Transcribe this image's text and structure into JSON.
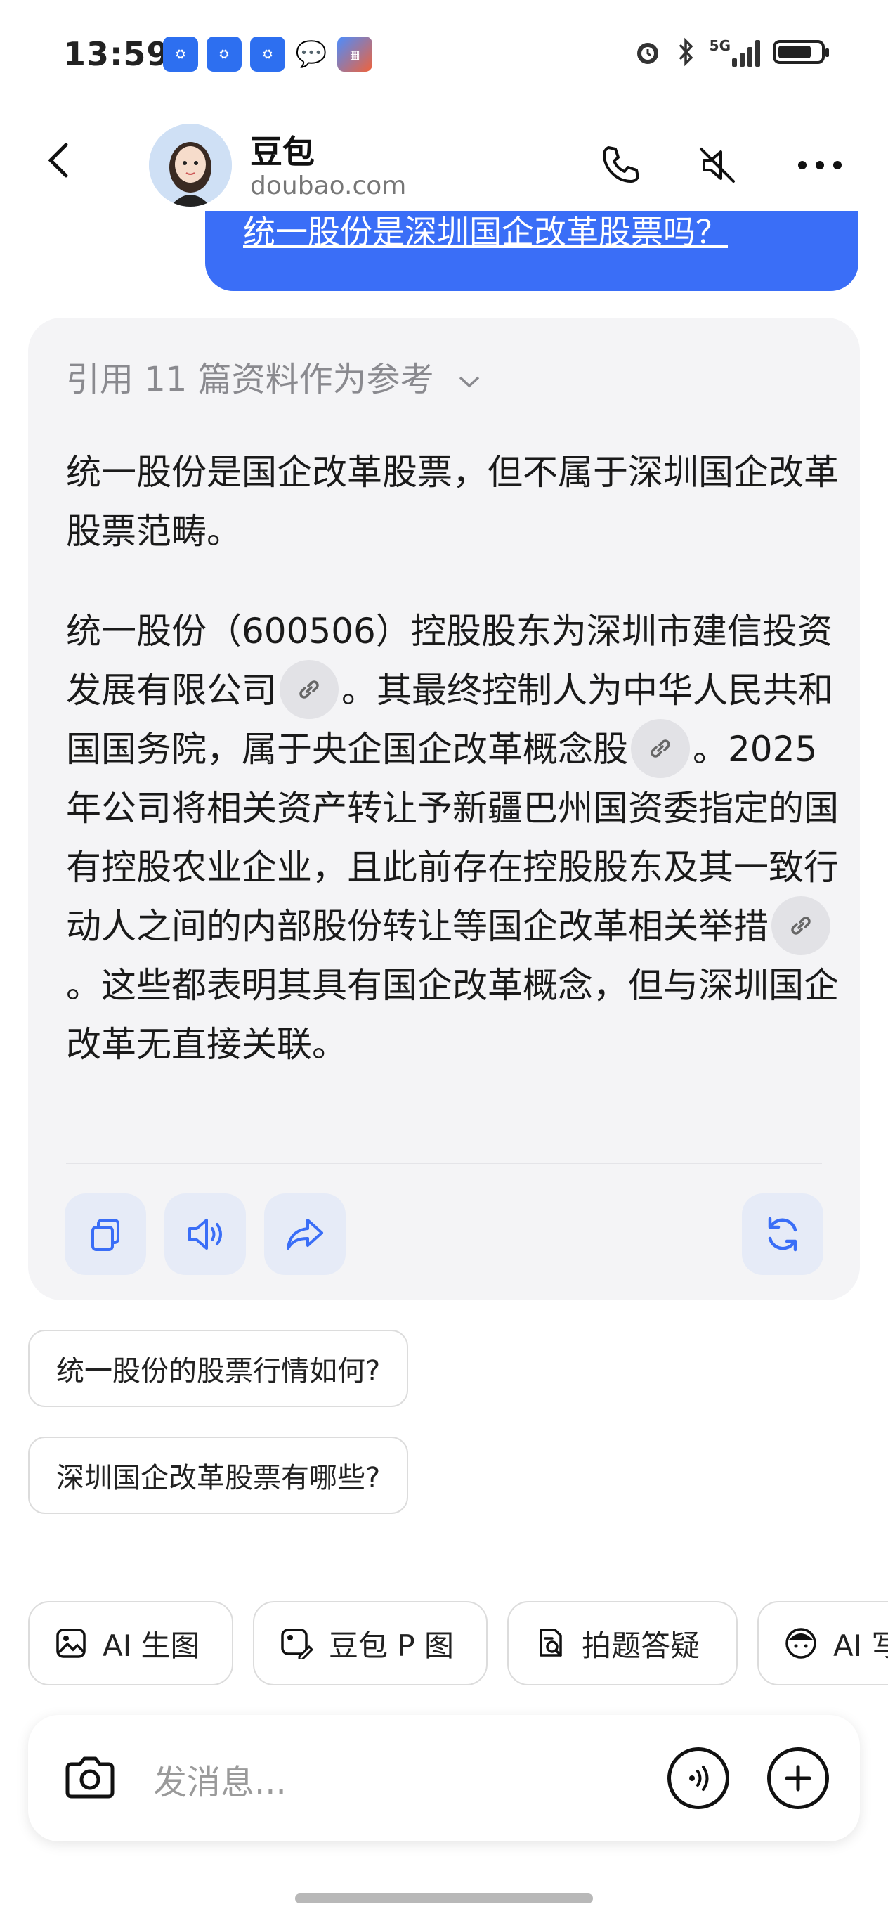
{
  "status_bar": {
    "time": "13:59",
    "network": "5G"
  },
  "header": {
    "title": "豆包",
    "subtitle": "doubao.com"
  },
  "user_message": "统一股份是深圳国企改革股票吗？",
  "answer": {
    "references_label": "引用 11 篇资料作为参考",
    "paragraph1": "统一股份是国企改革股票，但不属于深圳国企改革股票范畴。",
    "p2_seg1": "统一股份（600506）控股股东为深圳市建信投资发展有限公司",
    "p2_seg2": "。其最终控制人为中华人民共和国国务院，属于央企国企改革概念股",
    "p2_seg3": "。2025年公司将相关资产转让予新疆巴州国资委指定的国有控股农业企业，且此前存在控股股东及其一致行动人之间的内部股份转让等国企改革相关举措",
    "p2_seg4": "。这些都表明其具有国企改革概念，但与深圳国企改革无直接关联。"
  },
  "suggestions": [
    "统一股份的股票行情如何?",
    "深圳国企改革股票有哪些?"
  ],
  "tools": [
    {
      "label": "AI 生图",
      "icon": "image-icon"
    },
    {
      "label": "豆包 P 图",
      "icon": "photo-edit-icon"
    },
    {
      "label": "拍题答疑",
      "icon": "scan-question-icon"
    },
    {
      "label": "AI 写",
      "icon": "ai-write-icon"
    }
  ],
  "input": {
    "placeholder": "发消息..."
  },
  "colors": {
    "accent": "#3a6ef7",
    "card_bg": "#f4f4f6",
    "action_btn_bg": "#e6ebf7",
    "icon_blue": "#3a6ef7"
  }
}
